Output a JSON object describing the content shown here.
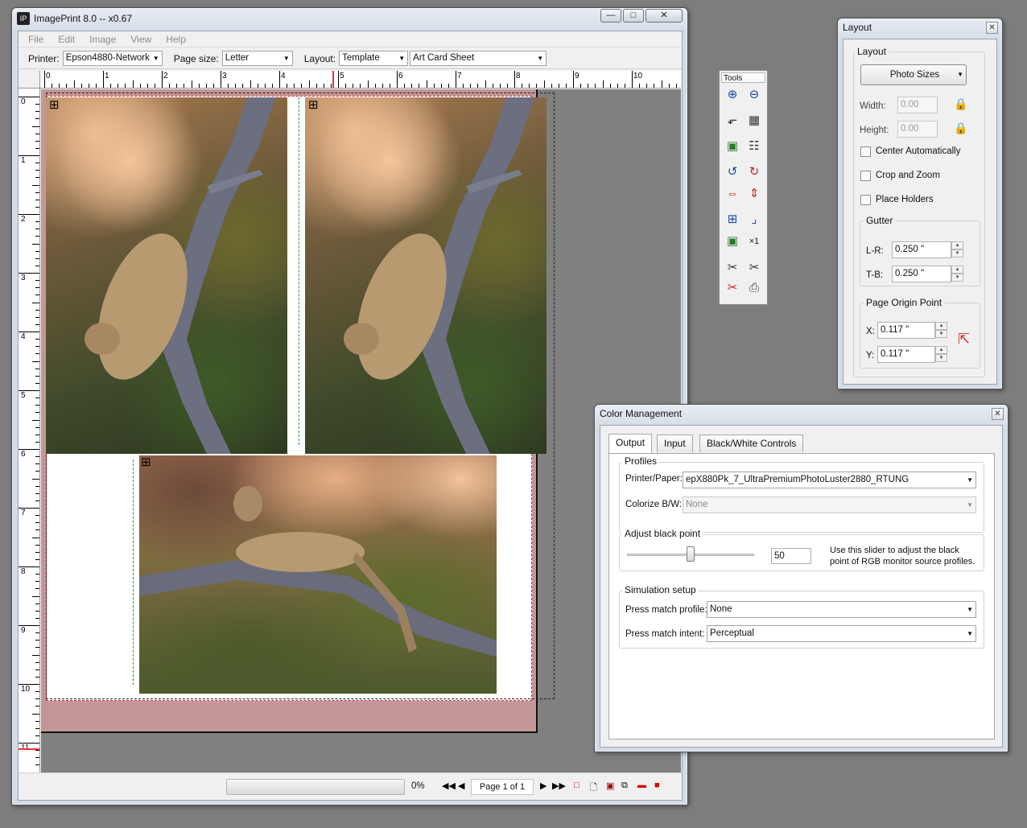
{
  "main_window": {
    "title": "ImagePrint 8.0 -- x0.67",
    "menu": [
      "File",
      "Edit",
      "Image",
      "View",
      "Help"
    ],
    "toolbar": {
      "printer_label": "Printer:",
      "printer_value": "Epson4880-Network",
      "page_size_label": "Page size:",
      "page_size_value": "Letter",
      "layout_label": "Layout:",
      "layout_value": "Template",
      "template_value": "Art Card Sheet"
    },
    "ruler_h": [
      "0",
      "1",
      "2",
      "3",
      "4",
      "5",
      "6",
      "7",
      "8",
      "9",
      "10"
    ],
    "ruler_v": [
      "0",
      "1",
      "2",
      "3",
      "4",
      "5",
      "6",
      "7",
      "8",
      "9",
      "10",
      "11"
    ],
    "status": {
      "progress_text": "0%",
      "progress": 0,
      "page_indicator": "Page 1 of 1"
    }
  },
  "tools_palette": {
    "title": "Tools",
    "icons": [
      "zoom-in-icon",
      "zoom-out-icon",
      "resize-icon",
      "grid-icon",
      "fit-icon",
      "tile-icon",
      "rotate-left-icon",
      "rotate-right-icon",
      "flip-horizontal-icon",
      "flip-vertical-icon",
      "center-icon",
      "crop-corner-icon",
      "frame-icon",
      "copies-icon",
      "scissors-icon",
      "scissors-alt-icon",
      "scissors-all-icon",
      "printer-icon"
    ]
  },
  "layout_panel": {
    "title": "Layout",
    "group_title": "Layout",
    "photo_sizes_button": "Photo Sizes",
    "width_label": "Width:",
    "width_value": "0.00",
    "height_label": "Height:",
    "height_value": "0.00",
    "center_auto": "Center Automatically",
    "crop_zoom": "Crop and Zoom",
    "place_holders": "Place Holders",
    "gutter_title": "Gutter",
    "lr_label": "L-R:",
    "lr_value": "0.250 \"",
    "tb_label": "T-B:",
    "tb_value": "0.250 \"",
    "origin_title": "Page Origin Point",
    "x_label": "X:",
    "x_value": "0.117 \"",
    "y_label": "Y:",
    "y_value": "0.117 \""
  },
  "color_panel": {
    "title": "Color Management",
    "tabs": [
      "Output",
      "Input",
      "Black/White Controls"
    ],
    "profiles_title": "Profiles",
    "printer_paper_label": "Printer/Paper:",
    "printer_paper_value": "epX880Pk_7_UltraPremiumPhotoLuster2880_RTUNG",
    "colorize_label": "Colorize B/W:",
    "colorize_value": "None",
    "black_point_title": "Adjust black point",
    "black_point_value": "50",
    "black_point_level": 50,
    "black_point_help_1": "Use this slider to adjust the black",
    "black_point_help_2": "point of RGB monitor source profiles.",
    "simulation_title": "Simulation setup",
    "press_profile_label": "Press match profile:",
    "press_profile_value": "None",
    "press_intent_label": "Press match intent:",
    "press_intent_value": "Perceptual"
  }
}
